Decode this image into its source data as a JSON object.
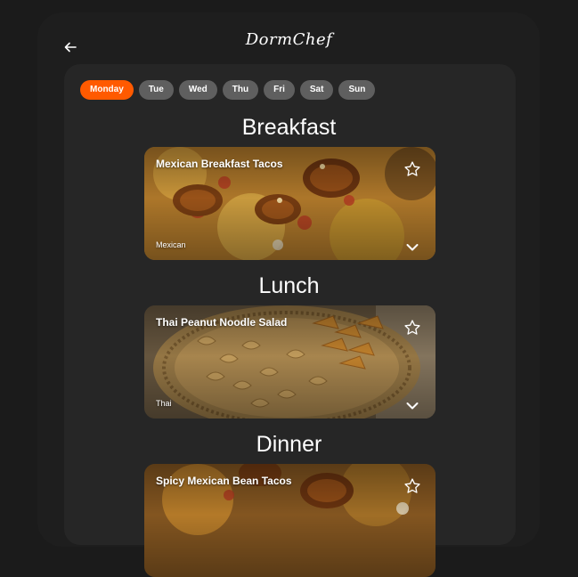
{
  "app": {
    "logo": "DormChef"
  },
  "days": [
    {
      "label": "Monday",
      "active": true
    },
    {
      "label": "Tue",
      "active": false
    },
    {
      "label": "Wed",
      "active": false
    },
    {
      "label": "Thu",
      "active": false
    },
    {
      "label": "Fri",
      "active": false
    },
    {
      "label": "Sat",
      "active": false
    },
    {
      "label": "Sun",
      "active": false
    }
  ],
  "meals": [
    {
      "section": "Breakfast",
      "title": "Mexican Breakfast Tacos",
      "cuisine": "Mexican"
    },
    {
      "section": "Lunch",
      "title": "Thai Peanut Noodle Salad",
      "cuisine": "Thai"
    },
    {
      "section": "Dinner",
      "title": "Spicy Mexican Bean Tacos",
      "cuisine": ""
    }
  ],
  "icons": {
    "back": "arrow-left-icon",
    "favorite": "star-outline-icon",
    "expand": "chevron-down-icon"
  },
  "colors": {
    "accent": "#ff5a00",
    "pill": "#5f5f5f",
    "background": "#1b1b1b",
    "panel": "#262626"
  }
}
